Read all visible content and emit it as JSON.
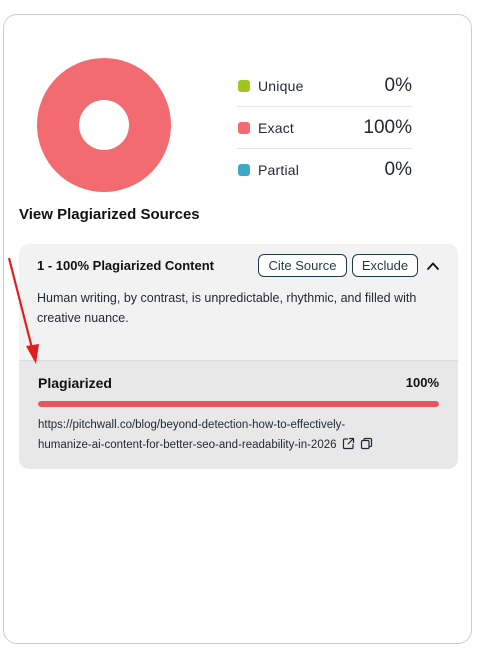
{
  "colors": {
    "unique": "#a0c520",
    "exact": "#f26b71",
    "partial": "#3ea8c6",
    "annotation_arrow": "#e01e1e"
  },
  "chart_data": {
    "type": "pie",
    "title": "",
    "categories": [
      "Unique",
      "Exact",
      "Partial"
    ],
    "values": [
      0,
      100,
      0
    ],
    "style": "donut"
  },
  "legend": [
    {
      "label": "Unique",
      "value": "0%"
    },
    {
      "label": "Exact",
      "value": "100%"
    },
    {
      "label": "Partial",
      "value": "0%"
    }
  ],
  "sources": {
    "title": "View Plagiarized Sources",
    "item": {
      "heading": "1 - 100% Plagiarized Content",
      "cite_label": "Cite Source",
      "exclude_label": "Exclude",
      "snippet": "Human writing, by contrast, is unpredictable, rhythmic, and filled with creative nuance.",
      "match_label": "Plagiarized",
      "match_percent": "100%",
      "match_fraction": 1.0,
      "url_line1": "https://pitchwall.co/blog/beyond-detection-how-to-effectively-",
      "url_line2": "humanize-ai-content-for-better-seo-and-readability-in-2026",
      "icons": [
        "chevron-up-icon",
        "external-link-icon",
        "copy-icon"
      ]
    }
  }
}
